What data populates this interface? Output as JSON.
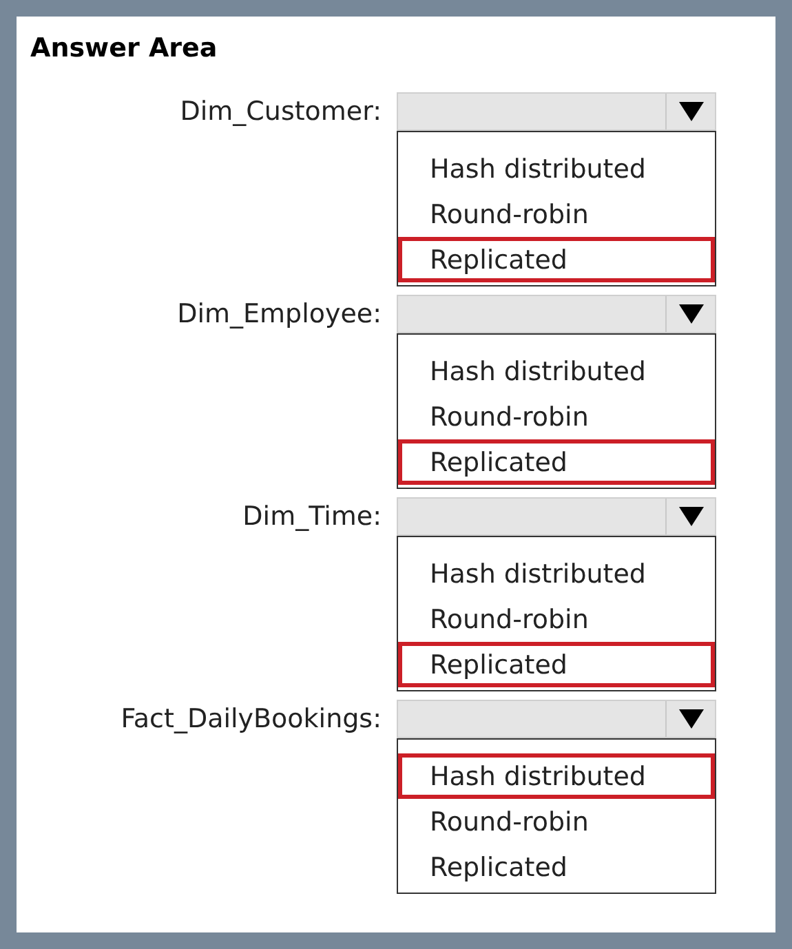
{
  "title": "Answer Area",
  "fields": [
    {
      "label": "Dim_Customer:",
      "options": [
        {
          "label": "Hash distributed",
          "selected": false
        },
        {
          "label": "Round-robin",
          "selected": false
        },
        {
          "label": "Replicated",
          "selected": true
        }
      ]
    },
    {
      "label": "Dim_Employee:",
      "options": [
        {
          "label": "Hash distributed",
          "selected": false
        },
        {
          "label": "Round-robin",
          "selected": false
        },
        {
          "label": "Replicated",
          "selected": true
        }
      ]
    },
    {
      "label": "Dim_Time:",
      "options": [
        {
          "label": "Hash distributed",
          "selected": false
        },
        {
          "label": "Round-robin",
          "selected": false
        },
        {
          "label": "Replicated",
          "selected": true
        }
      ]
    },
    {
      "label": "Fact_DailyBookings:",
      "options": [
        {
          "label": "Hash distributed",
          "selected": true
        },
        {
          "label": "Round-robin",
          "selected": false
        },
        {
          "label": "Replicated",
          "selected": false
        }
      ]
    }
  ]
}
